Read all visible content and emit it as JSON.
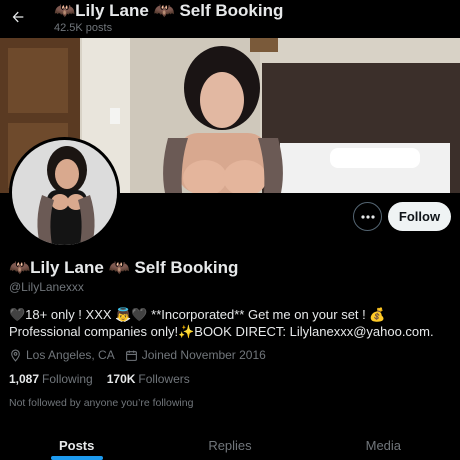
{
  "header": {
    "title": "🦇Lily Lane 🦇 Self Booking",
    "posts_count": "42.5K posts"
  },
  "profile": {
    "display_name": "🦇Lily Lane 🦇 Self Booking",
    "handle": "@LilyLanexxx",
    "bio": "🖤18+ only ! XXX 👼🖤 **Incorporated** Get me on your set ! 💰Professional companies only!✨BOOK DIRECT: Lilylanexxx@yahoo.com.",
    "location": "Los Angeles, CA",
    "joined": "Joined November 2016",
    "following_count": "1,087",
    "following_label": "Following",
    "followers_count": "170K",
    "followers_label": "Followers",
    "followed_note": "Not followed by anyone you’re following"
  },
  "actions": {
    "follow_label": "Follow",
    "more_icon": "more-icon"
  },
  "tabs": [
    {
      "label": "Posts",
      "active": true
    },
    {
      "label": "Replies",
      "active": false
    },
    {
      "label": "Media",
      "active": false
    }
  ],
  "colors": {
    "background": "#000000",
    "primary_text": "#e7e9ea",
    "secondary_text": "#71767b",
    "accent": "#1d9bf0",
    "follow_button_bg": "#eff3f4"
  }
}
